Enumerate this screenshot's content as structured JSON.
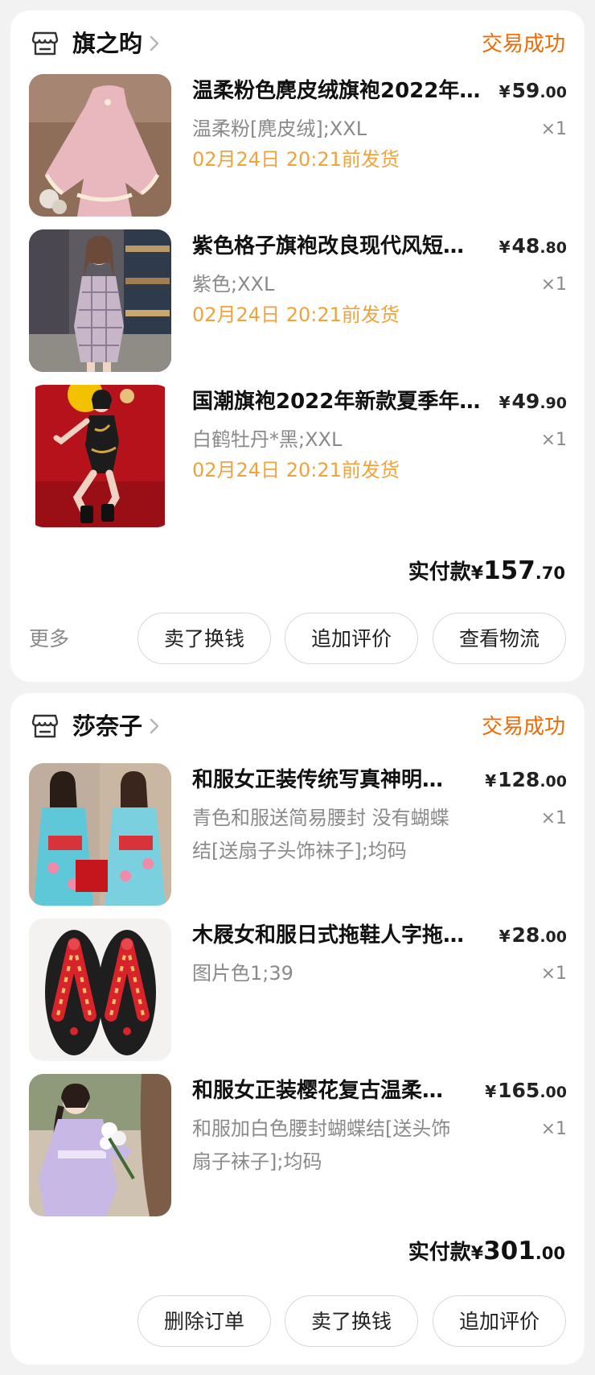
{
  "orders": [
    {
      "shop_name": "旗之昀",
      "status": "交易成功",
      "items": [
        {
          "title": "温柔粉色麂皮绒旗袍2022年…",
          "spec": "温柔粉[麂皮绒];XXL",
          "ship_note": "02月24日 20:21前发货",
          "price_currency": "¥",
          "price_int": "59",
          "price_dec": ".00",
          "qty": "×1"
        },
        {
          "title": "紫色格子旗袍改良现代风短…",
          "spec": "紫色;XXL",
          "ship_note": "02月24日 20:21前发货",
          "price_currency": "¥",
          "price_int": "48",
          "price_dec": ".80",
          "qty": "×1"
        },
        {
          "title": "国潮旗袍2022年新款夏季年…",
          "spec": "白鹤牡丹*黑;XXL",
          "ship_note": "02月24日 20:21前发货",
          "price_currency": "¥",
          "price_int": "49",
          "price_dec": ".90",
          "qty": "×1"
        }
      ],
      "total_label": "实付款",
      "total_currency": "¥",
      "total_int": "157",
      "total_dec": ".70",
      "more_label": "更多",
      "actions": [
        "卖了换钱",
        "追加评价",
        "查看物流"
      ]
    },
    {
      "shop_name": "莎奈子",
      "status": "交易成功",
      "items": [
        {
          "title": "和服女正装传统写真神明…",
          "spec": "青色和服送简易腰封 没有蝴蝶结[送扇子头饰袜子];均码",
          "price_currency": "¥",
          "price_int": "128",
          "price_dec": ".00",
          "qty": "×1"
        },
        {
          "title": "木屐女和服日式拖鞋人字拖…",
          "spec": "图片色1;39",
          "price_currency": "¥",
          "price_int": "28",
          "price_dec": ".00",
          "qty": "×1"
        },
        {
          "title": "和服女正装樱花复古温柔…",
          "spec": "和服加白色腰封蝴蝶结[送头饰扇子袜子];均码",
          "price_currency": "¥",
          "price_int": "165",
          "price_dec": ".00",
          "qty": "×1"
        }
      ],
      "total_label": "实付款",
      "total_currency": "¥",
      "total_int": "301",
      "total_dec": ".00",
      "actions": [
        "删除订单",
        "卖了换钱",
        "追加评价"
      ]
    }
  ],
  "colors": {
    "status": "#f06a00",
    "ship_note": "#f0a33c",
    "muted_text": "#8a8a8a",
    "background": "#f2f2f2"
  },
  "icons": {
    "shop": "shop-storefront-icon",
    "chevron": "chevron-right-icon"
  }
}
